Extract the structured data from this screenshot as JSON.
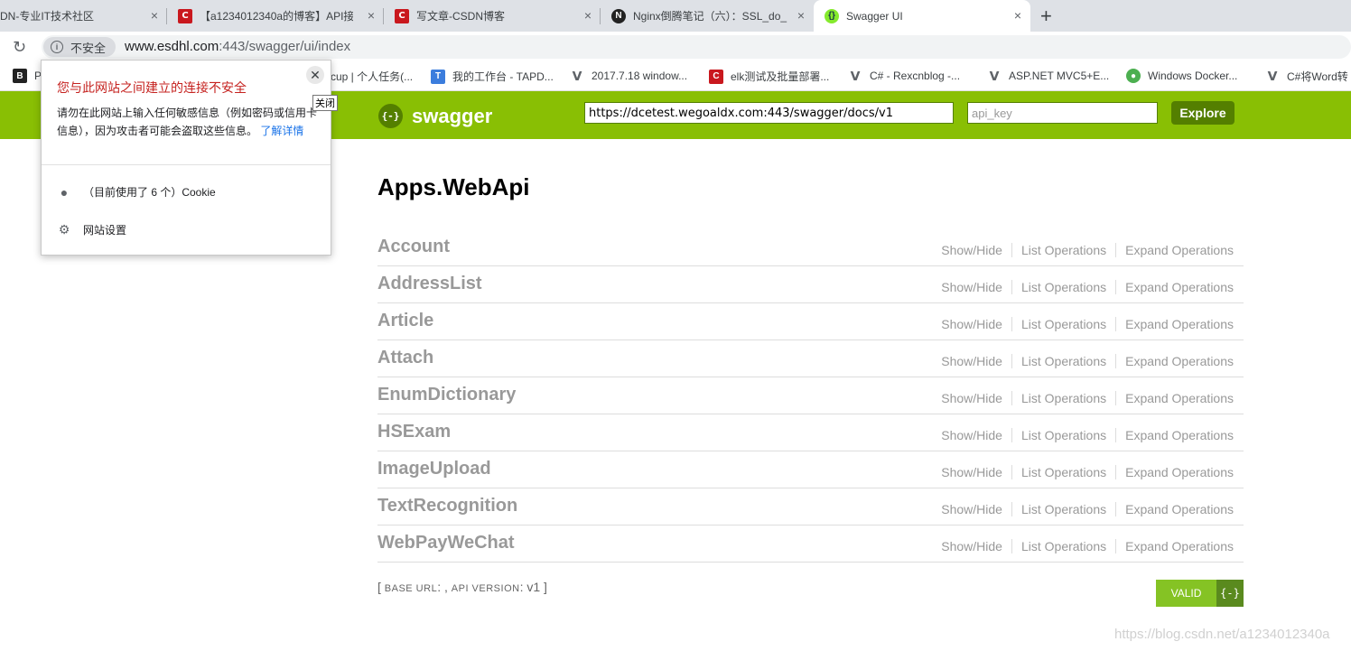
{
  "browser": {
    "tabs": [
      {
        "title": "DN-专业IT技术社区",
        "icon": "csdn-favicon"
      },
      {
        "title": "【a1234012340a的博客】API接",
        "icon": "csdn-favicon"
      },
      {
        "title": "写文章-CSDN博客",
        "icon": "csdn-favicon"
      },
      {
        "title": "Nginx倒腾笔记（六）：SSL_do_",
        "icon": "notion-favicon"
      },
      {
        "title": "Swagger UI",
        "icon": "swagger-favicon",
        "active": true
      }
    ],
    "close_glyph": "×",
    "new_tab_glyph": "+",
    "security_label": "不安全",
    "url_host": "www.esdhl.com",
    "url_rest": ":443/swagger/ui/index",
    "bookmarks": [
      {
        "label": "P",
        "icon": "b-icon"
      },
      {
        "label": "cup | 个人任务(...",
        "icon": "none"
      },
      {
        "label": "我的工作台 - TAPD...",
        "icon": "tapd-icon"
      },
      {
        "label": "2017.7.18 window...",
        "icon": "v-icon"
      },
      {
        "label": "elk测试及批量部署...",
        "icon": "csdn-icon"
      },
      {
        "label": "C# - Rexcnblog -...",
        "icon": "v-icon"
      },
      {
        "label": "ASP.NET MVC5+E...",
        "icon": "v-icon"
      },
      {
        "label": "Windows Docker...",
        "icon": "windows-docker-icon"
      },
      {
        "label": "C#将Word转",
        "icon": "v-icon"
      }
    ]
  },
  "popup": {
    "title": "您与此网站之间建立的连接不安全",
    "body": "请勿在此网站上输入任何敏感信息（例如密码或信用卡信息），因为攻击者可能会盗取这些信息。",
    "learn_more": "了解详情",
    "close_tooltip": "关闭",
    "cookie_label": "（目前使用了 6 个）Cookie",
    "site_settings_label": "网站设置"
  },
  "swagger": {
    "logo_text": "swagger",
    "logo_mark": "{-}",
    "url_value": "https://dcetest.wegoaldx.com:443/swagger/docs/v1",
    "api_key_placeholder": "api_key",
    "explore_label": "Explore",
    "api_title": "Apps.WebApi",
    "resources": [
      {
        "name": "Account"
      },
      {
        "name": "AddressList"
      },
      {
        "name": "Article"
      },
      {
        "name": "Attach"
      },
      {
        "name": "EnumDictionary"
      },
      {
        "name": "HSExam"
      },
      {
        "name": "ImageUpload"
      },
      {
        "name": "TextRecognition"
      },
      {
        "name": "WebPayWeChat"
      }
    ],
    "ops": {
      "show_hide": "Show/Hide",
      "list": "List Operations",
      "expand": "Expand Operations"
    },
    "footer": {
      "open": "[",
      "base_url_label": "base url",
      "base_url_value": ":  ,",
      "api_version_label": "api version",
      "api_version_value": ": v1",
      "close": "]"
    },
    "validator_label": "VALID",
    "validator_mark": "{-}"
  },
  "watermark": "https://blog.csdn.net/a1234012340a",
  "colors": {
    "swagger_green": "#89bf04",
    "swagger_dark": "#547f00",
    "warning_red": "#c5221f",
    "link_blue": "#1a73e8"
  }
}
